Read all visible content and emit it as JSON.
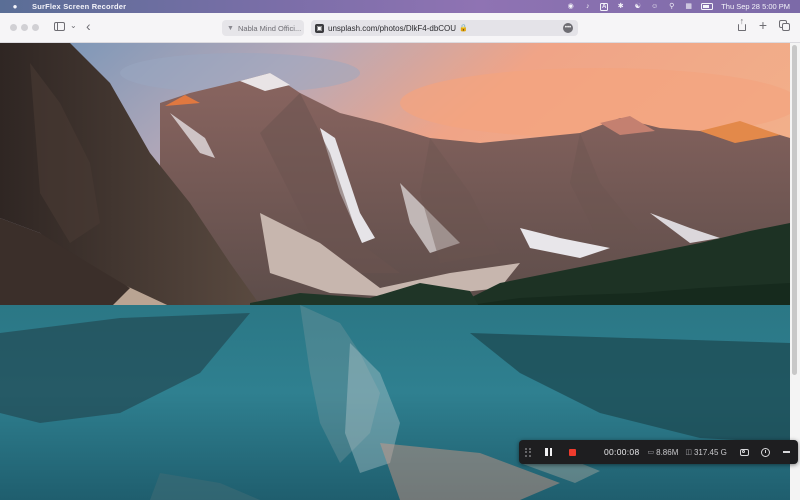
{
  "menubar": {
    "apple": "",
    "app_name": "SurFlex Screen Recorder",
    "input_source": "A",
    "datetime": "Thu Sep 28  5:00 PM"
  },
  "browser": {
    "inactive_tab": {
      "label": "Nabla Mind Offici..."
    },
    "url": "unsplash.com/photos/DlkF4-dbCOU",
    "url_more": "•••",
    "new_tab": "+"
  },
  "photo": {
    "description_icon": "mountain-lake-photo"
  },
  "recorder": {
    "elapsed": "00:00:08",
    "file_size": "8.86M",
    "free_space": "317.45 G"
  },
  "colors": {
    "menubar_start": "#5a6e96",
    "menubar_end": "#8f73b3",
    "record_red": "#ef3b2d",
    "recorder_bg": "#1e1e20",
    "lake": "#2a7886",
    "sky_glow": "#f2a07e"
  }
}
